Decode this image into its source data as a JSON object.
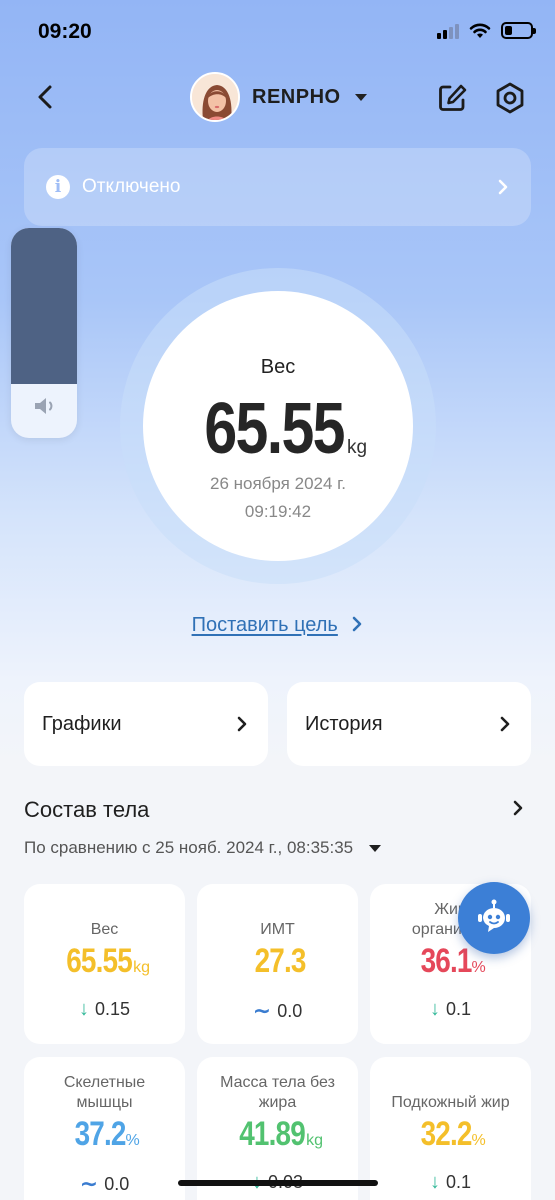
{
  "status_bar": {
    "time": "09:20"
  },
  "header": {
    "profile_name": "RENPHO"
  },
  "banner": {
    "text": "Отключено"
  },
  "weight": {
    "label": "Вес",
    "value": "65.55",
    "unit": "kg",
    "date": "26 ноября 2024 г.",
    "time": "09:19:42"
  },
  "goal_link": "Поставить цель",
  "nav_cards": [
    {
      "label": "Графики"
    },
    {
      "label": "История"
    }
  ],
  "body_composition": {
    "title": "Состав тела",
    "compare": "По сравнению с 25 нояб. 2024 г., 08:35:35",
    "metrics": [
      {
        "label": "Вес",
        "value": "65.55",
        "unit": "kg",
        "color": "#f4bf2a",
        "trend": "down",
        "change": "0.15"
      },
      {
        "label": "ИМТ",
        "value": "27.3",
        "unit": "",
        "color": "#f4bf2a",
        "trend": "flat",
        "change": "0.0"
      },
      {
        "label": "Жир организма",
        "value": "36.1",
        "unit": "%",
        "color": "#e5485a",
        "trend": "down",
        "change": "0.1"
      },
      {
        "label": "Скелетные мышцы",
        "value": "37.2",
        "unit": "%",
        "color": "#4fa4e6",
        "trend": "flat",
        "change": "0.0"
      },
      {
        "label": "Масса тела без жира",
        "value": "41.89",
        "unit": "kg",
        "color": "#52c270",
        "trend": "down",
        "change": "0.03"
      },
      {
        "label": "Подкожный жир",
        "value": "32.2",
        "unit": "%",
        "color": "#f4bf2a",
        "trend": "down",
        "change": "0.1"
      }
    ]
  },
  "colors": {
    "accent_link": "#3071b6",
    "banner_bg": "rgba(255,255,255,0.22)",
    "fab": "#3c7fd6"
  },
  "icons": [
    "back-chevron-icon",
    "edit-icon",
    "gear-icon",
    "info-icon",
    "chevron-right-icon",
    "volume-icon",
    "chat-bot-icon",
    "caret-down-icon"
  ]
}
